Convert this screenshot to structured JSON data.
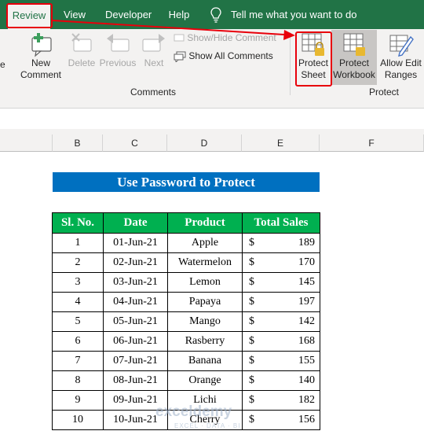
{
  "tabs": {
    "review": "Review",
    "view": "View",
    "developer": "Developer",
    "help": "Help"
  },
  "tell_me": "Tell me what you want to do",
  "ribbon": {
    "left_cut_letter": "e",
    "new_comment_line1": "New",
    "new_comment_line2": "Comment",
    "delete": "Delete",
    "previous": "Previous",
    "next": "Next",
    "show_hide_comment": "Show/Hide Comment",
    "show_all_comments": "Show All Comments",
    "comments_group": "Comments",
    "protect_sheet_line1": "Protect",
    "protect_sheet_line2": "Sheet",
    "protect_workbook_line1": "Protect",
    "protect_workbook_line2": "Workbook",
    "allow_edit_line1": "Allow Edit",
    "allow_edit_line2": "Ranges",
    "protect_group": "Protect"
  },
  "columns": [
    "B",
    "C",
    "D",
    "E",
    "F"
  ],
  "title": "Use Password to Protect",
  "table": {
    "headers": [
      "Sl. No.",
      "Date",
      "Product",
      "Total Sales"
    ],
    "currency": "$",
    "rows": [
      [
        "1",
        "01-Jun-21",
        "Apple",
        "189"
      ],
      [
        "2",
        "02-Jun-21",
        "Watermelon",
        "170"
      ],
      [
        "3",
        "03-Jun-21",
        "Lemon",
        "145"
      ],
      [
        "4",
        "04-Jun-21",
        "Papaya",
        "197"
      ],
      [
        "5",
        "05-Jun-21",
        "Mango",
        "142"
      ],
      [
        "6",
        "06-Jun-21",
        "Rasberry",
        "168"
      ],
      [
        "7",
        "07-Jun-21",
        "Banana",
        "155"
      ],
      [
        "8",
        "08-Jun-21",
        "Orange",
        "140"
      ],
      [
        "9",
        "09-Jun-21",
        "Lichi",
        "182"
      ],
      [
        "10",
        "10-Jun-21",
        "Cherry",
        "156"
      ]
    ]
  },
  "watermark": {
    "name": "exceldemy",
    "tagline": "EXCEL · DATA · BI"
  },
  "colors": {
    "excel_green": "#217346",
    "header_green": "#00b050",
    "title_blue": "#0070c0",
    "highlight_red": "#e8000b"
  }
}
